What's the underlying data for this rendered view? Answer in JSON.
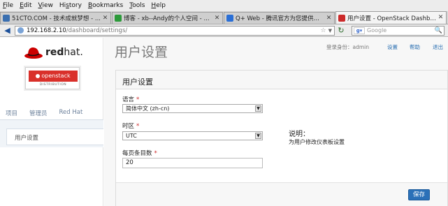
{
  "menu": [
    {
      "label": "File",
      "underline": "F",
      "rest": "ile"
    },
    {
      "label": "Edit",
      "underline": "E",
      "rest": "dit"
    },
    {
      "label": "View",
      "underline": "V",
      "rest": "iew"
    },
    {
      "label": "History",
      "pre": "Hi",
      "underline": "s",
      "rest": "tory"
    },
    {
      "label": "Bookmarks",
      "underline": "B",
      "rest": "ookmarks"
    },
    {
      "label": "Tools",
      "underline": "T",
      "rest": "ools"
    },
    {
      "label": "Help",
      "underline": "H",
      "rest": "elp"
    }
  ],
  "tabs": [
    {
      "label": "51CTO.COM - 技术成就梦想 - ...",
      "icon": "51cto-favicon",
      "color": "#3a6fb0"
    },
    {
      "label": "博客 - xb--Andy的个人空间 - ...",
      "icon": "blog-favicon",
      "color": "#2c9a3a"
    },
    {
      "label": "Q+ Web - 腾讯官方为您提供的...",
      "icon": "qq-favicon",
      "color": "#2a6fd6"
    },
    {
      "label": "用户设置 - OpenStack Dashbo...",
      "icon": "redhat-favicon",
      "color": "#cc2a2a",
      "active": true
    }
  ],
  "nav": {
    "url_host": "192.168.2.10",
    "url_path": "/dashboard/settings/",
    "search_placeholder": "Google",
    "search_engine": "Google"
  },
  "sidebar": {
    "brand": "redhat.",
    "brand_bold": "red",
    "brand_rest": "hat.",
    "product": "openstack",
    "distribution": "DISTRIBUTION",
    "tabs": [
      "项目",
      "管理员",
      "Red Hat"
    ],
    "active_item": "用户设置"
  },
  "header": {
    "title": "用户设置",
    "login_label": "登录身份：admin",
    "links": [
      "设置",
      "帮助",
      "退出"
    ]
  },
  "form": {
    "card_title": "用户设置",
    "language_label": "语言",
    "language_value": "简体中文 (zh-cn)",
    "timezone_label": "时区",
    "timezone_value": "UTC",
    "page_size_label": "每页条目数",
    "page_size_value": "20",
    "required_mark": "*",
    "desc_title": "说明：",
    "desc_text": "为用户修改仪表板设置",
    "save_label": "保存"
  },
  "colors": {
    "accent": "#2a70b8",
    "brand_red": "#cc0000"
  }
}
